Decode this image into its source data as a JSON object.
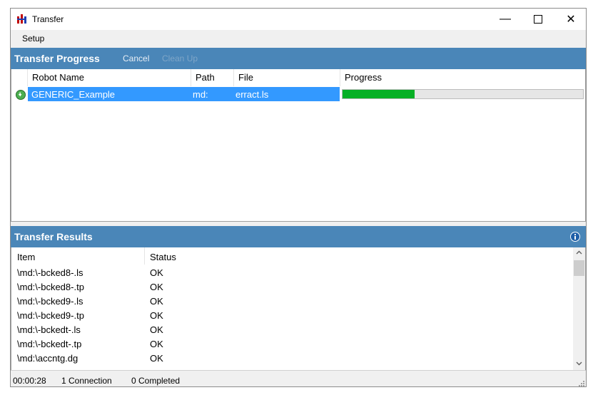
{
  "window": {
    "title": "Transfer"
  },
  "menu": {
    "items": [
      {
        "label": "Setup"
      }
    ]
  },
  "progress_panel": {
    "title": "Transfer Progress",
    "cancel_label": "Cancel",
    "cleanup_label": "Clean Up",
    "columns": [
      "Robot Name",
      "Path",
      "File",
      "Progress"
    ],
    "row": {
      "robot": "GENERIC_Example",
      "path": "md:",
      "file": "erract.ls",
      "progress": 0.3
    }
  },
  "results_panel": {
    "title": "Transfer Results",
    "columns": [
      "Item",
      "Status"
    ],
    "rows": [
      {
        "item": "\\md:\\-bcked8-.ls",
        "status": "OK"
      },
      {
        "item": "\\md:\\-bcked8-.tp",
        "status": "OK"
      },
      {
        "item": "\\md:\\-bcked9-.ls",
        "status": "OK"
      },
      {
        "item": "\\md:\\-bcked9-.tp",
        "status": "OK"
      },
      {
        "item": "\\md:\\-bckedt-.ls",
        "status": "OK"
      },
      {
        "item": "\\md:\\-bckedt-.tp",
        "status": "OK"
      },
      {
        "item": "\\md:\\accntg.dg",
        "status": "OK"
      }
    ]
  },
  "status_bar": {
    "elapsed": "00:00:28",
    "connections": "1 Connection",
    "completed": "0 Completed"
  },
  "colors": {
    "header": "#4a86b8",
    "selection": "#3399ff",
    "progress": "#06b025"
  }
}
